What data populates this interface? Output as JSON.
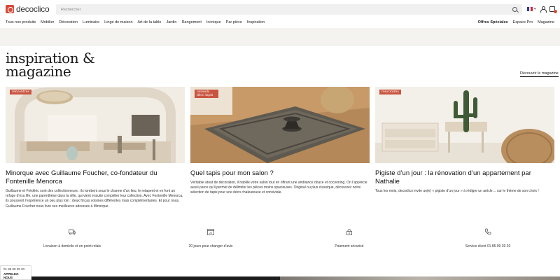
{
  "header": {
    "logo_text": "decoclico",
    "search_placeholder": "Rechercher"
  },
  "nav": {
    "items": [
      "Tous nos produits",
      "Mobilier",
      "Décoration",
      "Luminaire",
      "Linge de maison",
      "Art de la table",
      "Jardin",
      "Rangement",
      "Iconique",
      "Par pièce",
      "Inspiration"
    ],
    "right": [
      "Offres Spéciales",
      "Espace Pro",
      "Magazine"
    ]
  },
  "section": {
    "title_line1": "inspiration &",
    "title_line2": "magazine",
    "discover_link": "Découvrir le magazine"
  },
  "cards": [
    {
      "tag": "rencontres",
      "title": "Minorque avec Guillaume Foucher, co-fondateur du Fontenille Menorca",
      "text": "Guillaume et Frédéric sont des collectionneurs : ils tombent sous le charme d’un lieu, le retapent et en font un refuge d’exu life, une parenthèse dans la ville, qui vient ensuite compléter leur collection. Avec Fontenille Menorca, ils poussent l’expérience un peu plus loin : deux fincas voisines différentes mais complémentaires. Et pour nous, Guillaume Foucher nous livre ses meilleures adresses à Minorque."
    },
    {
      "tag": "conseils déco tapis",
      "title": "Quel tapis pour mon salon ?",
      "text": "Véritable atout de décoration, il habille votre salon tout en offrant une ambiance douce et cocooning. On l’apprécie aussi parce qu’il permet de délimiter les pièces moins spacieuses. Original ou plus classique, découvrez notre sélection de tapis pour une déco chaleureuse et conviviale."
    },
    {
      "tag": "rencontres",
      "title": "Pigiste d’un jour : la rénovation d’un appartement par Nathalie",
      "text": "Tous les mois, decoclico invite un(e) « pigiste d’un jour » à rédiger un article… sur le thème de son choix !"
    }
  ],
  "services": [
    {
      "label": "Livraison à domicile et en point relais",
      "icon": "truck-icon"
    },
    {
      "label": "20 jours pour changer d’avis",
      "icon": "calendar-icon"
    },
    {
      "label": "Paiement sécurisé",
      "icon": "lock-icon"
    },
    {
      "label": "Service client 01 85 09 39 20",
      "icon": "phone-icon"
    }
  ],
  "phone_widget": {
    "number": "01 85 09 39 20",
    "call_label": "APPELEZ-NOUS"
  },
  "colors": {
    "brand": "#d64a3c",
    "tag": "#c9543f",
    "band": "#f4f3ef"
  }
}
